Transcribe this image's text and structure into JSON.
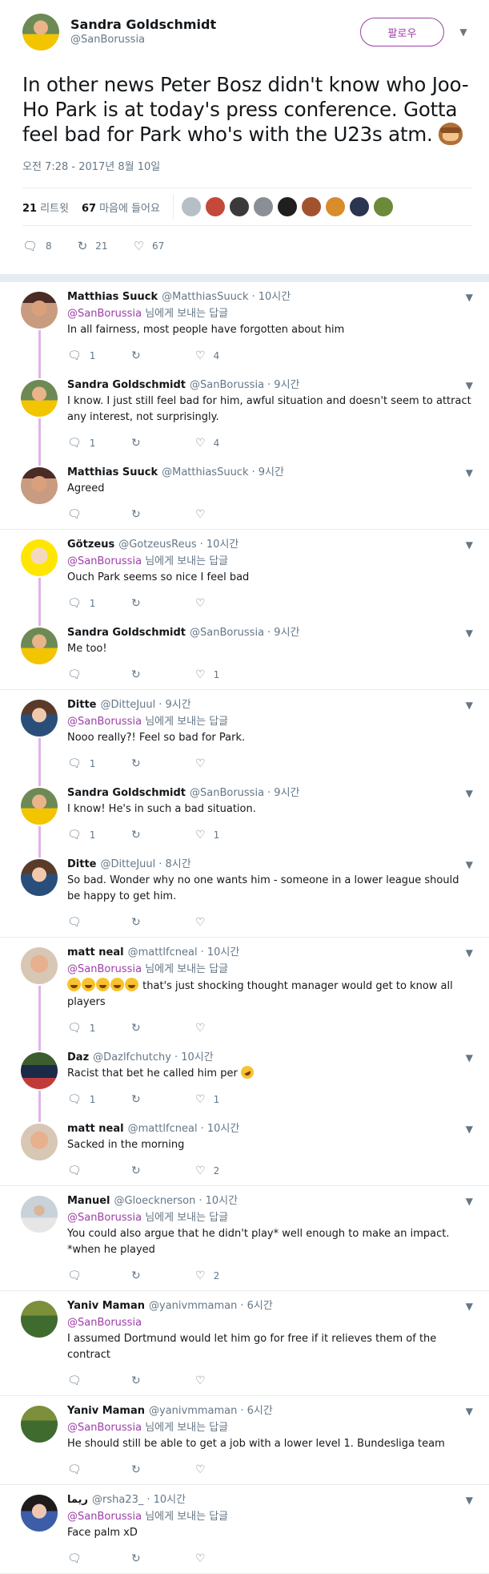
{
  "main_tweet": {
    "name": "Sandra Goldschmidt",
    "handle": "@SanBorussia",
    "follow_label": "팔로우",
    "text": "In other news Peter Bosz didn't know who Joo-Ho Park is at today's press conference. Gotta feel bad for Park who's with the U23s atm.",
    "emoji": "see-no-evil-monkey",
    "date": "오전 7:28 - 2017년 8월 10일",
    "retweets_count": "21",
    "retweets_label": "리트윗",
    "likes_count": "67",
    "likes_label": "마음에 들어요",
    "actions": {
      "replies": "8",
      "retweets": "21",
      "likes": "67"
    }
  },
  "reply_to_label": "님에게 보내는 답글",
  "conversations": [
    {
      "replies": [
        {
          "name": "Matthias Suuck",
          "handle": "@MatthiasSuuck",
          "time": "· 10시간",
          "to": "@SanBorussia",
          "text": "In all fairness, most people have forgotten about him",
          "r": "1",
          "rt": "",
          "l": "4"
        },
        {
          "name": "Sandra Goldschmidt",
          "handle": "@SanBorussia",
          "time": "· 9시간",
          "to": "",
          "text": "I know. I just still feel bad for him, awful situation and doesn't seem to attract any interest, not surprisingly.",
          "r": "1",
          "rt": "",
          "l": "4"
        },
        {
          "name": "Matthias Suuck",
          "handle": "@MatthiasSuuck",
          "time": "· 9시간",
          "to": "",
          "text": "Agreed",
          "r": "",
          "rt": "",
          "l": ""
        }
      ]
    },
    {
      "replies": [
        {
          "name": "Götzeus",
          "handle": "@GotzeusReus",
          "time": "· 10시간",
          "to": "@SanBorussia",
          "text": "Ouch Park seems so nice I feel bad",
          "r": "1",
          "rt": "",
          "l": ""
        },
        {
          "name": "Sandra Goldschmidt",
          "handle": "@SanBorussia",
          "time": "· 9시간",
          "to": "",
          "text": "Me too!",
          "r": "",
          "rt": "",
          "l": "1"
        }
      ]
    },
    {
      "replies": [
        {
          "name": "Ditte",
          "handle": "@DitteJuul",
          "time": "· 9시간",
          "to": "@SanBorussia",
          "text": "Nooo really?! Feel so bad for Park.",
          "r": "1",
          "rt": "",
          "l": ""
        },
        {
          "name": "Sandra Goldschmidt",
          "handle": "@SanBorussia",
          "time": "· 9시간",
          "to": "",
          "text": "I know! He's in such a bad situation.",
          "r": "1",
          "rt": "",
          "l": "1"
        },
        {
          "name": "Ditte",
          "handle": "@DitteJuul",
          "time": "· 8시간",
          "to": "",
          "text": "So bad. Wonder why no one wants him - someone in a lower league should be happy to get him.",
          "r": "",
          "rt": "",
          "l": ""
        }
      ]
    },
    {
      "replies": [
        {
          "name": "matt neal",
          "handle": "@mattlfcneal",
          "time": "· 10시간",
          "to": "@SanBorussia",
          "text": "that's just shocking thought manager would get to know all players",
          "r": "1",
          "rt": "",
          "l": ""
        },
        {
          "name": "Daz",
          "handle": "@Dazlfchutchy",
          "time": "· 10시간",
          "to": "",
          "text": "Racist that bet he called him per",
          "r": "1",
          "rt": "",
          "l": "1"
        },
        {
          "name": "matt neal",
          "handle": "@mattlfcneal",
          "time": "· 10시간",
          "to": "",
          "text": "Sacked in the morning",
          "r": "",
          "rt": "",
          "l": "2"
        }
      ]
    },
    {
      "replies": [
        {
          "name": "Manuel",
          "handle": "@Gloecknerson",
          "time": "· 10시간",
          "to": "@SanBorussia",
          "text": "You could also argue that he didn't play* well enough to make an impact. *when he played",
          "r": "",
          "rt": "",
          "l": "2"
        }
      ]
    },
    {
      "replies": [
        {
          "name": "Yaniv Maman",
          "handle": "@yanivmmaman",
          "time": "· 6시간",
          "to": "@SanBorussia",
          "to_plain": true,
          "text": "I assumed Dortmund would let him go for free if it relieves them of the contract",
          "r": "",
          "rt": "",
          "l": ""
        }
      ]
    },
    {
      "replies": [
        {
          "name": "Yaniv Maman",
          "handle": "@yanivmmaman",
          "time": "· 6시간",
          "to": "@SanBorussia",
          "text": "He should still be able to get a job with a lower level 1. Bundesliga team",
          "r": "",
          "rt": "",
          "l": ""
        }
      ]
    },
    {
      "replies": [
        {
          "name": "ريما",
          "handle": "@rsha23_",
          "time": "· 10시간",
          "to": "@SanBorussia",
          "text": "Face palm xD",
          "r": "",
          "rt": "",
          "l": ""
        }
      ]
    }
  ],
  "colors": {
    "accent": "#9d3ea8",
    "thread_line": "#e1b3e9",
    "muted": "#657786"
  }
}
